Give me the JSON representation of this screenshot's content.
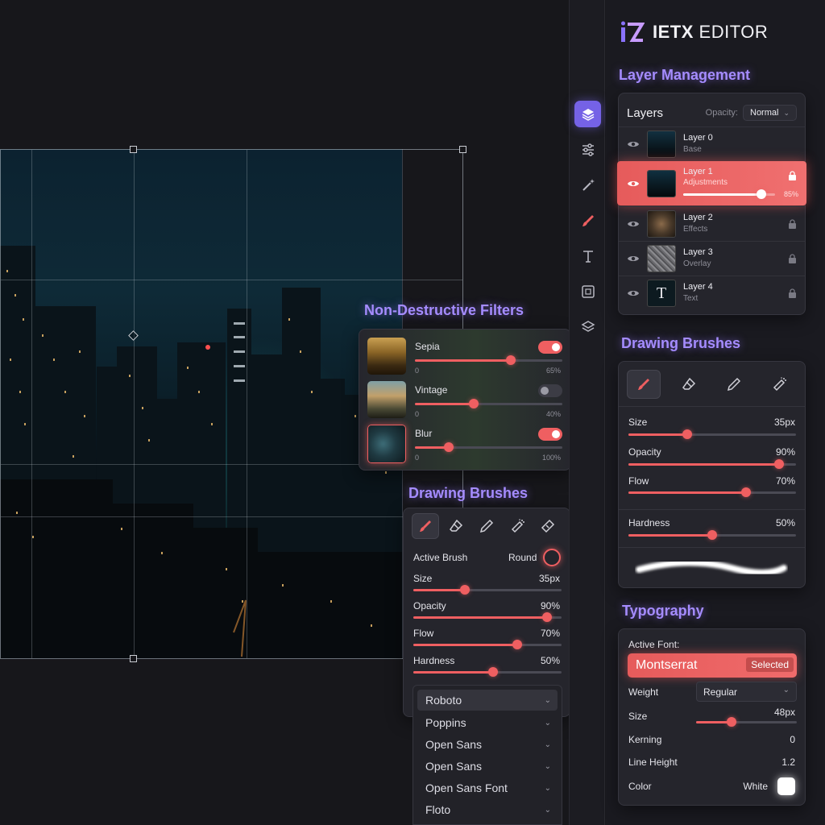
{
  "app": {
    "name_bold": "IETX",
    "name_light": "EDITOR"
  },
  "toolbar": {
    "tools": [
      {
        "icon": "layers-icon",
        "active": true
      },
      {
        "icon": "sliders-icon",
        "active": false
      },
      {
        "icon": "magic-wand-icon",
        "active": false
      },
      {
        "icon": "brush-icon",
        "active": false
      },
      {
        "icon": "text-icon",
        "active": false
      },
      {
        "icon": "image-frame-icon",
        "active": false
      },
      {
        "icon": "stack-icon",
        "active": false
      }
    ]
  },
  "layer_management": {
    "section_title": "Layer Management",
    "panel_title": "Layers",
    "opacity_label": "Opacity:",
    "blend_mode": "Normal",
    "layers": [
      {
        "name": "Layer 0",
        "sub": "Base",
        "locked": false
      },
      {
        "name": "Layer 1",
        "sub": "Adjustments",
        "locked": true,
        "active": true,
        "opacity_label": "85%",
        "opacity": 0.85
      },
      {
        "name": "Layer 2",
        "sub": "Effects",
        "locked": true
      },
      {
        "name": "Layer 3",
        "sub": "Overlay",
        "locked": true
      },
      {
        "name": "Layer 4",
        "sub": "Text",
        "locked": true,
        "thumb_letter": "T"
      }
    ]
  },
  "filters": {
    "section_title": "Non-Destructive Filters",
    "items": [
      {
        "name": "Sepia",
        "enabled": true,
        "min_label": "0",
        "value_label": "65%",
        "value": 0.65
      },
      {
        "name": "Vintage",
        "enabled": false,
        "min_label": "0",
        "value_label": "40%",
        "value": 0.4
      },
      {
        "name": "Blur",
        "enabled": true,
        "min_label": "0",
        "value_label": "100%",
        "value": 0.23
      }
    ]
  },
  "brushes_float": {
    "section_title": "Drawing Brushes",
    "active_brush_label": "Active Brush",
    "active_brush_value": "Round",
    "sliders": [
      {
        "label": "Size",
        "value_label": "35px",
        "value": 0.35
      },
      {
        "label": "Opacity",
        "value_label": "90%",
        "value": 0.9
      },
      {
        "label": "Flow",
        "value_label": "70%",
        "value": 0.7
      },
      {
        "label": "Hardness",
        "value_label": "50%",
        "value": 0.54
      }
    ],
    "fonts": [
      "Roboto",
      "Poppins",
      "Open Sans",
      "Open Sans",
      "Open Sans Font",
      "Floto"
    ]
  },
  "brushes_panel": {
    "section_title": "Drawing Brushes",
    "sliders": [
      {
        "label": "Size",
        "value_label": "35px",
        "value": 0.35
      },
      {
        "label": "Opacity",
        "value_label": "90%",
        "value": 0.9
      },
      {
        "label": "Flow",
        "value_label": "70%",
        "value": 0.7
      },
      {
        "label": "Hardness",
        "value_label": "50%",
        "value": 0.5
      }
    ]
  },
  "typography": {
    "section_title": "Typography",
    "active_font_label": "Active Font:",
    "active_font": "Montserrat",
    "selected_badge": "Selected",
    "weight_label": "Weight",
    "weight_value": "Regular",
    "size_label": "Size",
    "size_value": "48px",
    "size_fraction": 0.35,
    "kerning_label": "Kerning",
    "kerning_value": "0",
    "line_height_label": "Line Height",
    "line_height_value": "1.2",
    "color_label": "Color",
    "color_value": "White"
  },
  "colors": {
    "accent_red": "#ef5f61",
    "accent_purple": "#a58cff",
    "tool_active": "#7562e6"
  }
}
